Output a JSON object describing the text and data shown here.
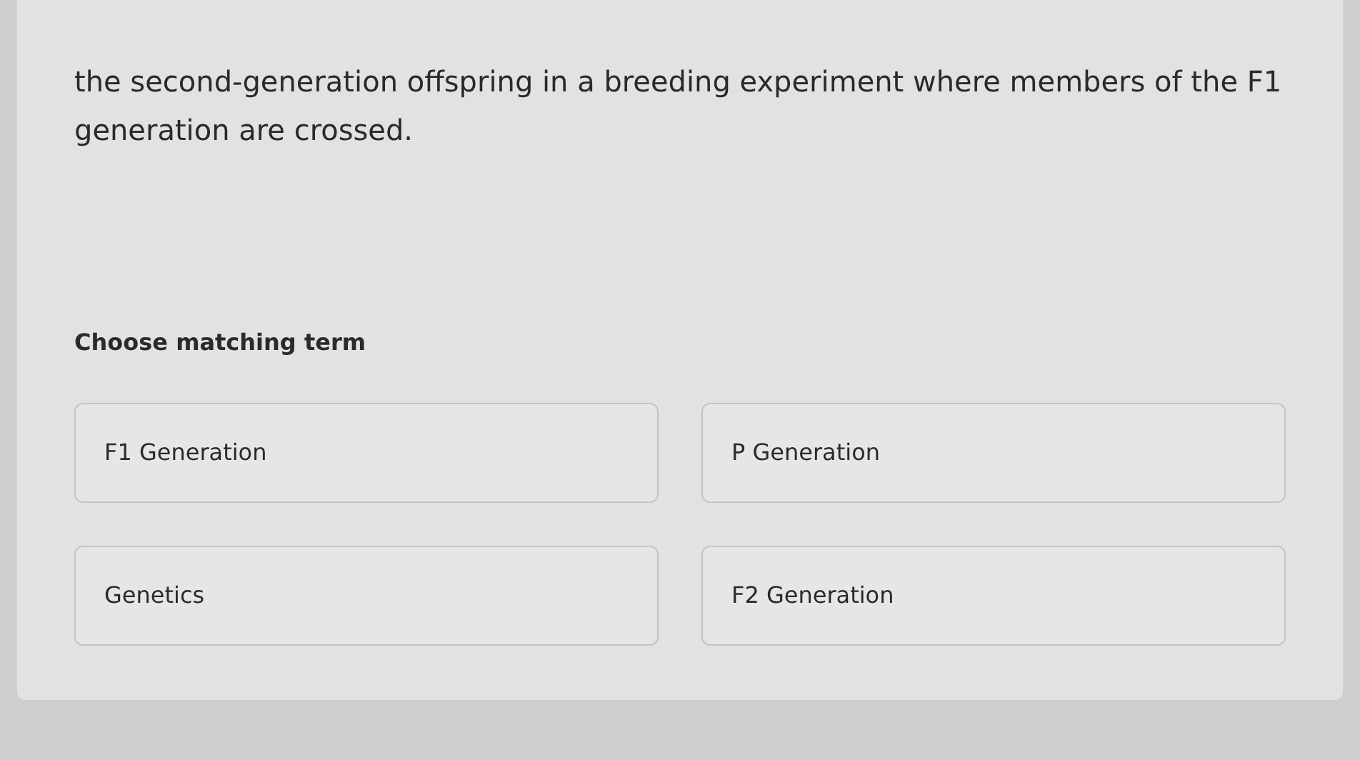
{
  "question": "the second-generation offspring in a breeding experiment where members of the F1 generation are crossed.",
  "prompt": "Choose matching term",
  "options": [
    {
      "label": "F1 Generation",
      "selected": false
    },
    {
      "label": "P Generation",
      "selected": false
    },
    {
      "label": "Genetics",
      "selected": false
    },
    {
      "label": "F2 Generation",
      "selected": false
    }
  ]
}
